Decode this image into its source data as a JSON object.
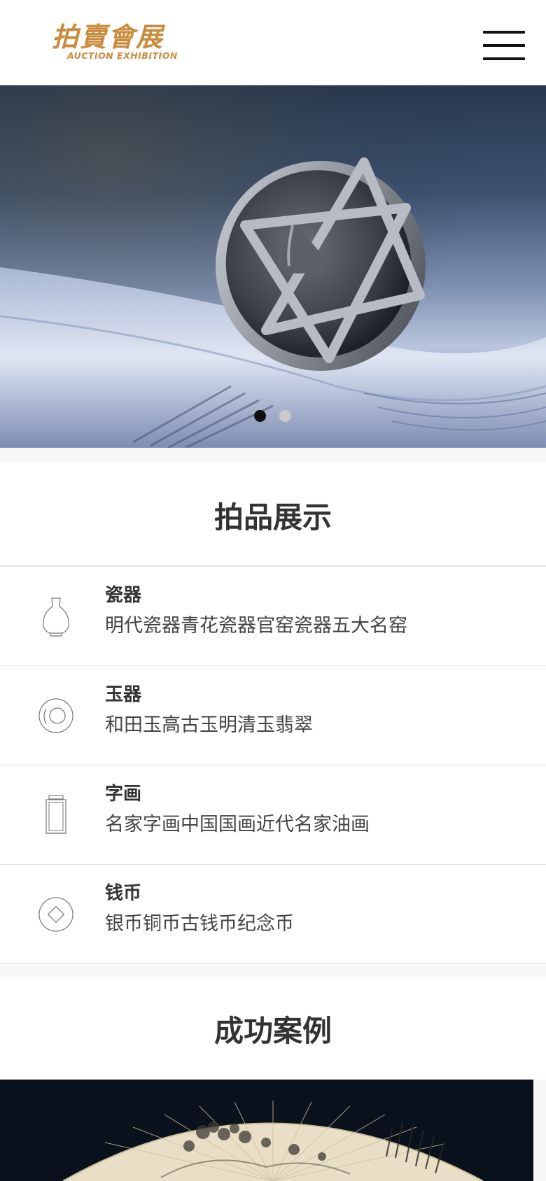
{
  "header": {
    "logo_cn": "拍賣會展",
    "logo_en": "AUCTION EXHIBITION",
    "menu_icon": "hamburger-menu-icon"
  },
  "banner": {
    "slide_count": 2,
    "active_slide": 1
  },
  "showcase": {
    "title": "拍品展示",
    "categories": [
      {
        "name": "瓷器",
        "desc": "明代瓷器青花瓷器官窑瓷器五大名窑",
        "icon": "vase-icon"
      },
      {
        "name": "玉器",
        "desc": "和田玉高古玉明清玉翡翠",
        "icon": "jade-disc-icon"
      },
      {
        "name": "字画",
        "desc": "名家字画中国国画近代名家油画",
        "icon": "scroll-icon"
      },
      {
        "name": "钱币",
        "desc": "银币铜币古钱币纪念币",
        "icon": "coin-icon"
      }
    ]
  },
  "cases": {
    "title": "成功案例"
  },
  "colors": {
    "brand_gold": "#c98b3c",
    "text_dark": "#333333",
    "page_bg": "#f7f7f7"
  }
}
